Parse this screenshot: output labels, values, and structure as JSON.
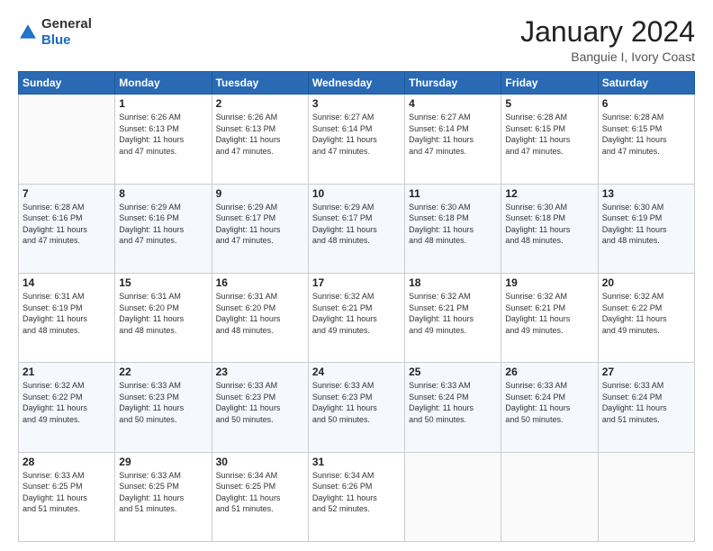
{
  "header": {
    "logo_general": "General",
    "logo_blue": "Blue",
    "month_title": "January 2024",
    "subtitle": "Banguie I, Ivory Coast"
  },
  "weekdays": [
    "Sunday",
    "Monday",
    "Tuesday",
    "Wednesday",
    "Thursday",
    "Friday",
    "Saturday"
  ],
  "weeks": [
    [
      {
        "day": "",
        "info": ""
      },
      {
        "day": "1",
        "info": "Sunrise: 6:26 AM\nSunset: 6:13 PM\nDaylight: 11 hours\nand 47 minutes."
      },
      {
        "day": "2",
        "info": "Sunrise: 6:26 AM\nSunset: 6:13 PM\nDaylight: 11 hours\nand 47 minutes."
      },
      {
        "day": "3",
        "info": "Sunrise: 6:27 AM\nSunset: 6:14 PM\nDaylight: 11 hours\nand 47 minutes."
      },
      {
        "day": "4",
        "info": "Sunrise: 6:27 AM\nSunset: 6:14 PM\nDaylight: 11 hours\nand 47 minutes."
      },
      {
        "day": "5",
        "info": "Sunrise: 6:28 AM\nSunset: 6:15 PM\nDaylight: 11 hours\nand 47 minutes."
      },
      {
        "day": "6",
        "info": "Sunrise: 6:28 AM\nSunset: 6:15 PM\nDaylight: 11 hours\nand 47 minutes."
      }
    ],
    [
      {
        "day": "7",
        "info": "Sunrise: 6:28 AM\nSunset: 6:16 PM\nDaylight: 11 hours\nand 47 minutes."
      },
      {
        "day": "8",
        "info": "Sunrise: 6:29 AM\nSunset: 6:16 PM\nDaylight: 11 hours\nand 47 minutes."
      },
      {
        "day": "9",
        "info": "Sunrise: 6:29 AM\nSunset: 6:17 PM\nDaylight: 11 hours\nand 47 minutes."
      },
      {
        "day": "10",
        "info": "Sunrise: 6:29 AM\nSunset: 6:17 PM\nDaylight: 11 hours\nand 48 minutes."
      },
      {
        "day": "11",
        "info": "Sunrise: 6:30 AM\nSunset: 6:18 PM\nDaylight: 11 hours\nand 48 minutes."
      },
      {
        "day": "12",
        "info": "Sunrise: 6:30 AM\nSunset: 6:18 PM\nDaylight: 11 hours\nand 48 minutes."
      },
      {
        "day": "13",
        "info": "Sunrise: 6:30 AM\nSunset: 6:19 PM\nDaylight: 11 hours\nand 48 minutes."
      }
    ],
    [
      {
        "day": "14",
        "info": "Sunrise: 6:31 AM\nSunset: 6:19 PM\nDaylight: 11 hours\nand 48 minutes."
      },
      {
        "day": "15",
        "info": "Sunrise: 6:31 AM\nSunset: 6:20 PM\nDaylight: 11 hours\nand 48 minutes."
      },
      {
        "day": "16",
        "info": "Sunrise: 6:31 AM\nSunset: 6:20 PM\nDaylight: 11 hours\nand 48 minutes."
      },
      {
        "day": "17",
        "info": "Sunrise: 6:32 AM\nSunset: 6:21 PM\nDaylight: 11 hours\nand 49 minutes."
      },
      {
        "day": "18",
        "info": "Sunrise: 6:32 AM\nSunset: 6:21 PM\nDaylight: 11 hours\nand 49 minutes."
      },
      {
        "day": "19",
        "info": "Sunrise: 6:32 AM\nSunset: 6:21 PM\nDaylight: 11 hours\nand 49 minutes."
      },
      {
        "day": "20",
        "info": "Sunrise: 6:32 AM\nSunset: 6:22 PM\nDaylight: 11 hours\nand 49 minutes."
      }
    ],
    [
      {
        "day": "21",
        "info": "Sunrise: 6:32 AM\nSunset: 6:22 PM\nDaylight: 11 hours\nand 49 minutes."
      },
      {
        "day": "22",
        "info": "Sunrise: 6:33 AM\nSunset: 6:23 PM\nDaylight: 11 hours\nand 50 minutes."
      },
      {
        "day": "23",
        "info": "Sunrise: 6:33 AM\nSunset: 6:23 PM\nDaylight: 11 hours\nand 50 minutes."
      },
      {
        "day": "24",
        "info": "Sunrise: 6:33 AM\nSunset: 6:23 PM\nDaylight: 11 hours\nand 50 minutes."
      },
      {
        "day": "25",
        "info": "Sunrise: 6:33 AM\nSunset: 6:24 PM\nDaylight: 11 hours\nand 50 minutes."
      },
      {
        "day": "26",
        "info": "Sunrise: 6:33 AM\nSunset: 6:24 PM\nDaylight: 11 hours\nand 50 minutes."
      },
      {
        "day": "27",
        "info": "Sunrise: 6:33 AM\nSunset: 6:24 PM\nDaylight: 11 hours\nand 51 minutes."
      }
    ],
    [
      {
        "day": "28",
        "info": "Sunrise: 6:33 AM\nSunset: 6:25 PM\nDaylight: 11 hours\nand 51 minutes."
      },
      {
        "day": "29",
        "info": "Sunrise: 6:33 AM\nSunset: 6:25 PM\nDaylight: 11 hours\nand 51 minutes."
      },
      {
        "day": "30",
        "info": "Sunrise: 6:34 AM\nSunset: 6:25 PM\nDaylight: 11 hours\nand 51 minutes."
      },
      {
        "day": "31",
        "info": "Sunrise: 6:34 AM\nSunset: 6:26 PM\nDaylight: 11 hours\nand 52 minutes."
      },
      {
        "day": "",
        "info": ""
      },
      {
        "day": "",
        "info": ""
      },
      {
        "day": "",
        "info": ""
      }
    ]
  ]
}
